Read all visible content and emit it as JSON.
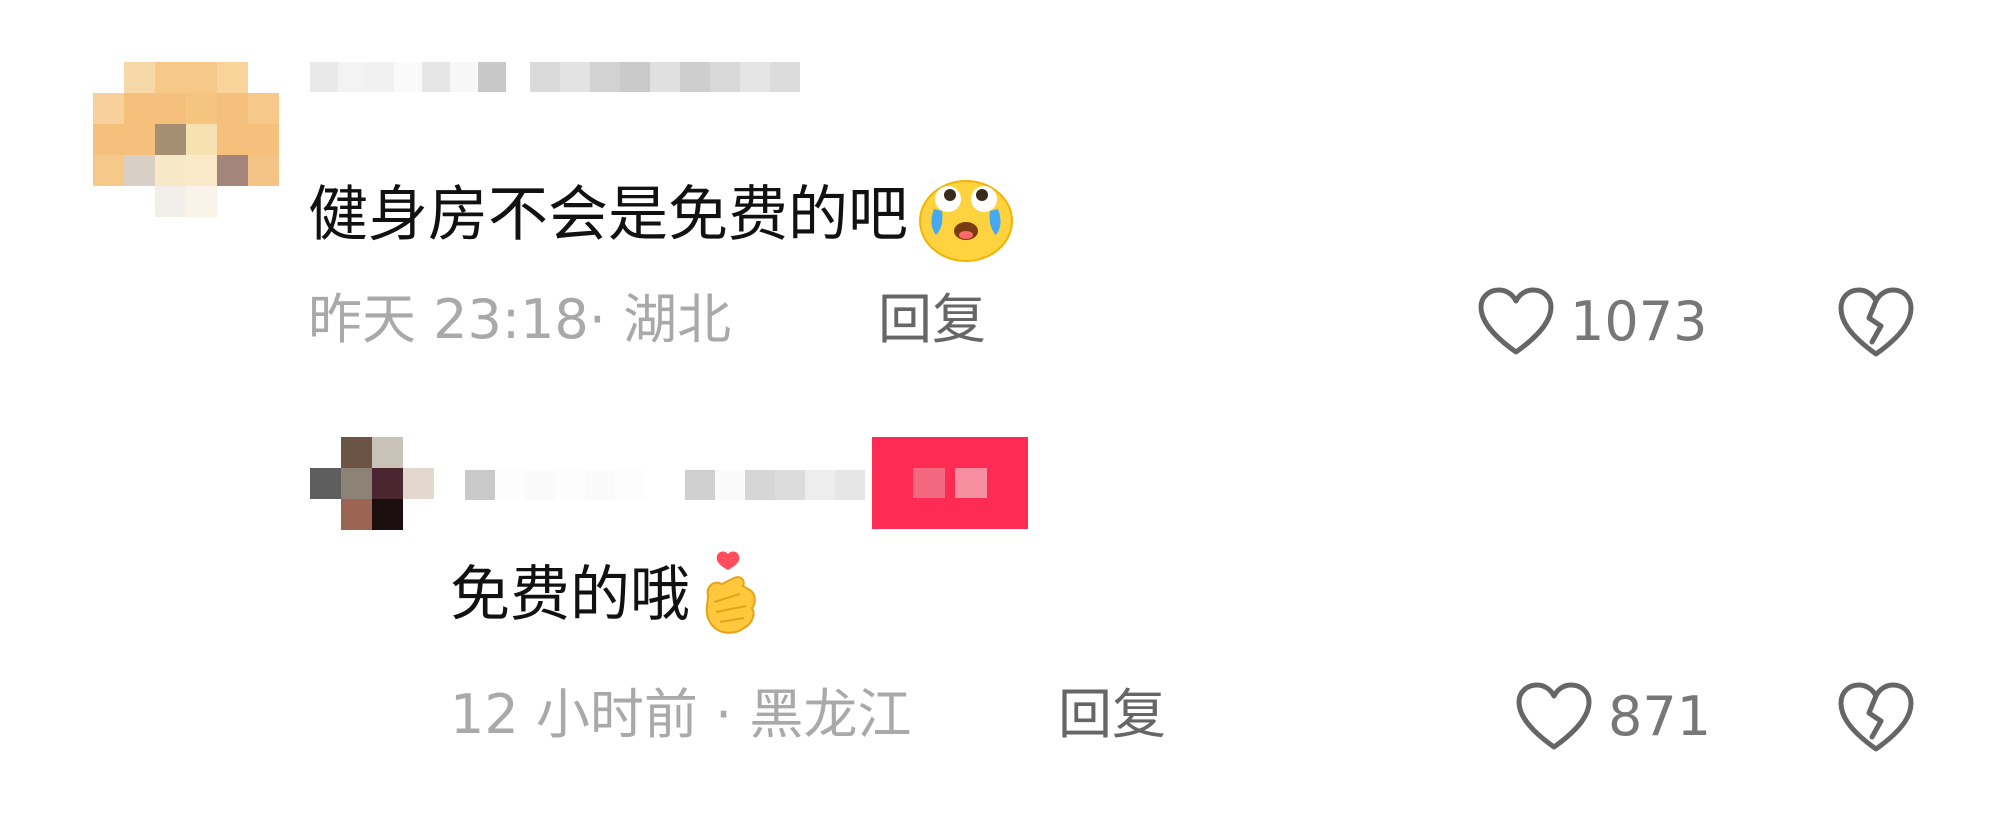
{
  "comments": [
    {
      "text": "健身房不会是免费的吧",
      "emoji_icon": "crying-laughing-emoji",
      "time": "昨天 23:18",
      "location": "湖北",
      "meta_sep": "· ",
      "reply_label": "回复",
      "like_count": "1073"
    },
    {
      "text": "免费的哦",
      "emoji_icon": "finger-heart-emoji",
      "time": "12 小时前",
      "location": "黑龙江",
      "meta_sep": " · ",
      "reply_label": "回复",
      "like_count": "871"
    }
  ],
  "colors": {
    "text": "#111111",
    "meta": "#a9a9a9",
    "reply": "#666666",
    "like_count": "#777777",
    "author_tag": "#fe2c55"
  }
}
